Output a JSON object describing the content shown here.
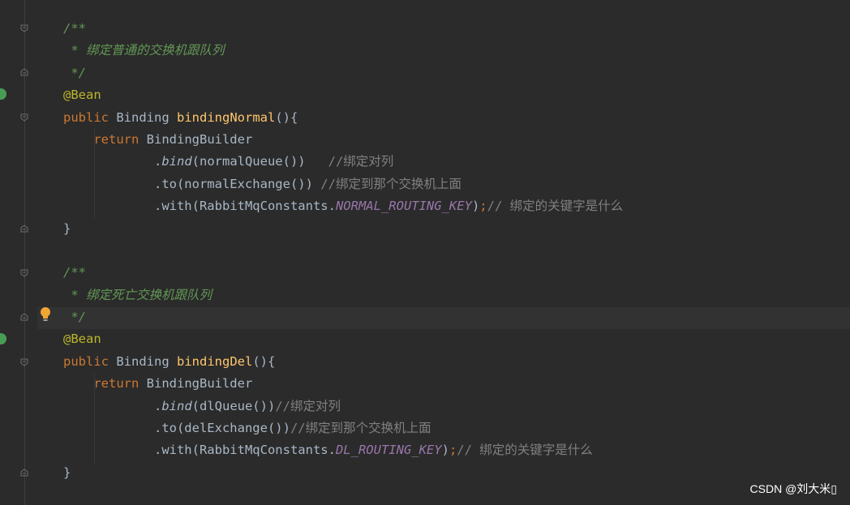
{
  "code": {
    "block1": {
      "doc_open": "/**",
      "doc_text": " * 绑定普通的交换机跟队列",
      "doc_close": " */",
      "annotation": "@Bean",
      "sig_public": "public",
      "sig_type": " Binding ",
      "sig_method": "bindingNormal",
      "sig_rest": "(){",
      "ret_kw": "return",
      "ret_rest": " BindingBuilder",
      "bind_dot": ".",
      "bind_fn": "bind",
      "bind_args": "(normalQueue())",
      "bind_comment": "   //绑定对列",
      "to_call": ".to(normalExchange()) ",
      "to_comment": "//绑定到那个交换机上面",
      "with_call": ".with(RabbitMqConstants.",
      "with_const": "NORMAL_ROUTING_KEY",
      "with_close": ")",
      "with_semi": ";",
      "with_comment": "// 绑定的关键字是什么",
      "close_brace": "}"
    },
    "block2": {
      "doc_open": "/**",
      "doc_text": " * 绑定死亡交换机跟队列",
      "doc_close": " */",
      "annotation": "@Bean",
      "sig_public": "public",
      "sig_type": " Binding ",
      "sig_method": "bindingDel",
      "sig_rest": "(){",
      "ret_kw": "return",
      "ret_rest": " BindingBuilder",
      "bind_dot": ".",
      "bind_fn": "bind",
      "bind_args": "(dlQueue())",
      "bind_comment": "//绑定对列",
      "to_call": ".to(delExchange())",
      "to_comment": "//绑定到那个交换机上面",
      "with_call": ".with(RabbitMqConstants.",
      "with_const": "DL_ROUTING_KEY",
      "with_close": ")",
      "with_semi": ";",
      "with_comment": "// 绑定的关键字是什么",
      "close_brace": "}"
    }
  },
  "watermark": "CSDN @刘大米▯",
  "icons": [
    "fold-icon",
    "bean-gutter-icon",
    "lightbulb-icon"
  ],
  "colors": {
    "background": "#2b2b2b",
    "comment": "#629755",
    "keyword": "#cc7832",
    "annotation": "#bbb529",
    "method": "#ffc66d",
    "constant": "#9876aa",
    "text": "#a9b7c6"
  }
}
